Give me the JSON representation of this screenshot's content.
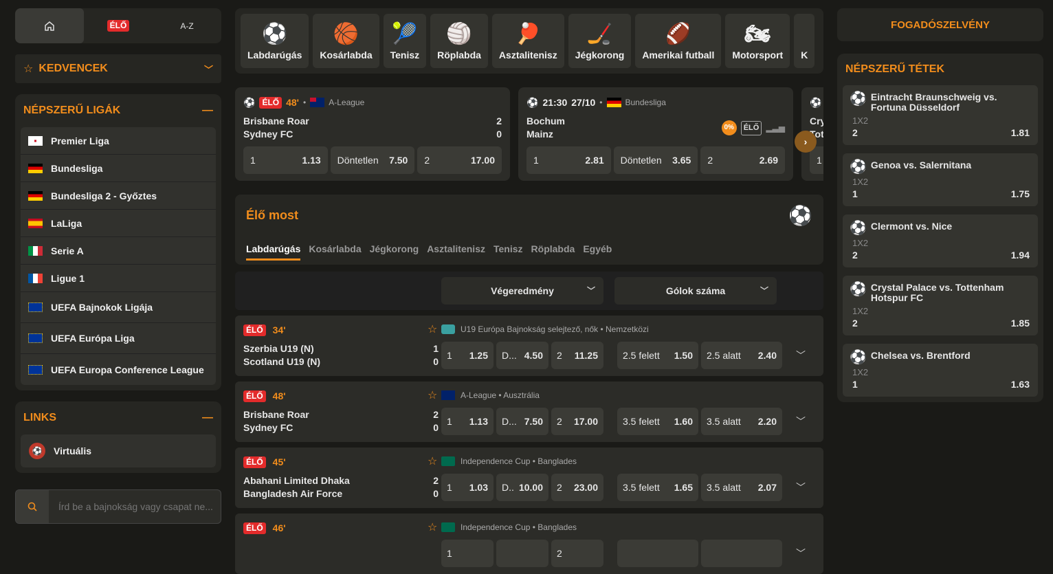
{
  "topnav": {
    "live": "ÉLŐ",
    "az": "A-Z"
  },
  "favorites": {
    "title": "KEDVENCEK"
  },
  "leagues": {
    "title": "NÉPSZERŰ LIGÁK",
    "items": [
      {
        "label": "Premier Liga",
        "flag": "eng"
      },
      {
        "label": "Bundesliga",
        "flag": "de"
      },
      {
        "label": "Bundesliga 2 - Győztes",
        "flag": "de"
      },
      {
        "label": "LaLiga",
        "flag": "es"
      },
      {
        "label": "Serie A",
        "flag": "it"
      },
      {
        "label": "Ligue 1",
        "flag": "fr"
      },
      {
        "label": "UEFA Bajnokok Ligája",
        "flag": "eu"
      },
      {
        "label": "UEFA Európa Liga",
        "flag": "eu"
      },
      {
        "label": "UEFA Europa Conference League",
        "flag": "eu"
      }
    ]
  },
  "links": {
    "title": "LINKS",
    "items": [
      {
        "label": "Virtuális"
      }
    ]
  },
  "search": {
    "placeholder": "Írd be a bajnokság vagy csapat ne..."
  },
  "sports": [
    {
      "label": "Labdarúgás",
      "icon": "⚽"
    },
    {
      "label": "Kosárlabda",
      "icon": "🏀"
    },
    {
      "label": "Tenisz",
      "icon": "🎾"
    },
    {
      "label": "Röplabda",
      "icon": "🏐"
    },
    {
      "label": "Asztalitenisz",
      "icon": "🏓"
    },
    {
      "label": "Jégkorong",
      "icon": "🏒"
    },
    {
      "label": "Amerikai futball",
      "icon": "🏈"
    },
    {
      "label": "Motorsport",
      "icon": "🏍"
    },
    {
      "label": "K",
      "icon": ""
    }
  ],
  "featured": [
    {
      "live": "ÉLŐ",
      "minute": "48'",
      "league": "A-League",
      "home": "Brisbane Roar",
      "away": "Sydney FC",
      "home_score": "2",
      "away_score": "0",
      "odds": [
        {
          "l": "1",
          "v": "1.13"
        },
        {
          "l": "Döntetlen",
          "v": "7.50"
        },
        {
          "l": "2",
          "v": "17.00"
        }
      ]
    },
    {
      "time": "21:30",
      "date": "27/10",
      "league": "Bundesliga",
      "home": "Bochum",
      "away": "Mainz",
      "pct": "0%",
      "elo": "ÉLŐ",
      "odds": [
        {
          "l": "1",
          "v": "2.81"
        },
        {
          "l": "Döntetlen",
          "v": "3.65"
        },
        {
          "l": "2",
          "v": "2.69"
        }
      ]
    },
    {
      "home": "Cry",
      "away": "Tot",
      "odds": [
        {
          "l": "1",
          "v": ""
        }
      ]
    }
  ],
  "live_now": {
    "title": "Élő most",
    "tabs": [
      "Labdarúgás",
      "Kosárlabda",
      "Jégkorong",
      "Asztalitenisz",
      "Tenisz",
      "Röplabda",
      "Egyéb"
    ]
  },
  "filters": {
    "result": "Végeredmény",
    "goals": "Gólok száma"
  },
  "matches": [
    {
      "live": "ÉLŐ",
      "minute": "34'",
      "league": "U19 Európa Bajnokság selejtező, nők • Nemzetközi",
      "flag": "world",
      "home": "Szerbia U19 (N)",
      "away": "Scotland U19 (N)",
      "hs": "1",
      "as": "0",
      "o1": "1.25",
      "ox_l": "D...",
      "ox": "4.50",
      "o2": "11.25",
      "over_l": "2.5 felett",
      "over": "1.50",
      "under_l": "2.5 alatt",
      "under": "2.40"
    },
    {
      "live": "ÉLŐ",
      "minute": "48'",
      "league": "A-League • Ausztrália",
      "flag": "au",
      "home": "Brisbane Roar",
      "away": "Sydney FC",
      "hs": "2",
      "as": "0",
      "o1": "1.13",
      "ox_l": "D...",
      "ox": "7.50",
      "o2": "17.00",
      "over_l": "3.5 felett",
      "over": "1.60",
      "under_l": "3.5 alatt",
      "under": "2.20"
    },
    {
      "live": "ÉLŐ",
      "minute": "45'",
      "league": "Independence Cup • Banglades",
      "flag": "bd",
      "home": "Abahani Limited Dhaka",
      "away": "Bangladesh Air Force",
      "hs": "2",
      "as": "0",
      "o1": "1.03",
      "ox_l": "D..",
      "ox": "10.00",
      "o2": "23.00",
      "over_l": "3.5 felett",
      "over": "1.65",
      "under_l": "3.5 alatt",
      "under": "2.07"
    },
    {
      "live": "ÉLŐ",
      "minute": "46'",
      "league": "Independence Cup • Banglades",
      "flag": "bd",
      "home": "",
      "away": "",
      "hs": "",
      "as": "",
      "o1": "",
      "ox_l": "",
      "ox": "",
      "o2": "",
      "over_l": "",
      "over": "",
      "under_l": "",
      "under": ""
    }
  ],
  "betslip": {
    "title": "FOGADÓSZELVÉNY"
  },
  "popular": {
    "title": "NÉPSZERŰ TÉTEK",
    "items": [
      {
        "match": "Eintracht Braunschweig vs. Fortuna Düsseldorf",
        "market": "1X2",
        "sel": "2",
        "odd": "1.81"
      },
      {
        "match": "Genoa vs. Salernitana",
        "market": "1X2",
        "sel": "1",
        "odd": "1.75"
      },
      {
        "match": "Clermont vs. Nice",
        "market": "1X2",
        "sel": "2",
        "odd": "1.94"
      },
      {
        "match": "Crystal Palace vs. Tottenham Hotspur FC",
        "market": "1X2",
        "sel": "2",
        "odd": "1.85"
      },
      {
        "match": "Chelsea vs. Brentford",
        "market": "1X2",
        "sel": "1",
        "odd": "1.63"
      }
    ]
  },
  "colors": {
    "accent": "#f28d1c",
    "live": "#e32b2b",
    "bg": "#1a1a17"
  }
}
